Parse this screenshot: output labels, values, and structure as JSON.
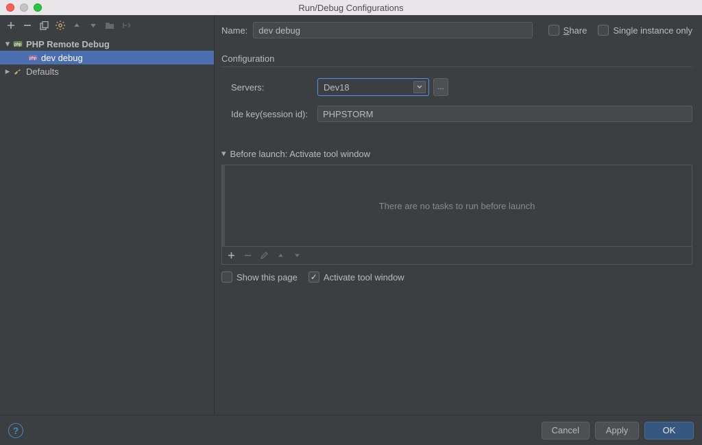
{
  "window": {
    "title": "Run/Debug Configurations"
  },
  "tree": {
    "root": {
      "label": "PHP Remote Debug"
    },
    "child": {
      "label": "dev debug"
    },
    "defaults": {
      "label": "Defaults"
    }
  },
  "form": {
    "name_label": "Name:",
    "name_value": "dev debug",
    "share_label": "Share",
    "single_label": "Single instance only",
    "config_title": "Configuration",
    "servers_label": "Servers:",
    "servers_value": "Dev18",
    "ellipsis": "...",
    "idekey_label": "Ide key(session id):",
    "idekey_value": "PHPSTORM"
  },
  "before": {
    "header": "Before launch: Activate tool window",
    "empty_text": "There are no tasks to run before launch",
    "show_page": "Show this page",
    "activate": "Activate tool window"
  },
  "footer": {
    "help": "?",
    "cancel": "Cancel",
    "apply": "Apply",
    "ok": "OK"
  }
}
